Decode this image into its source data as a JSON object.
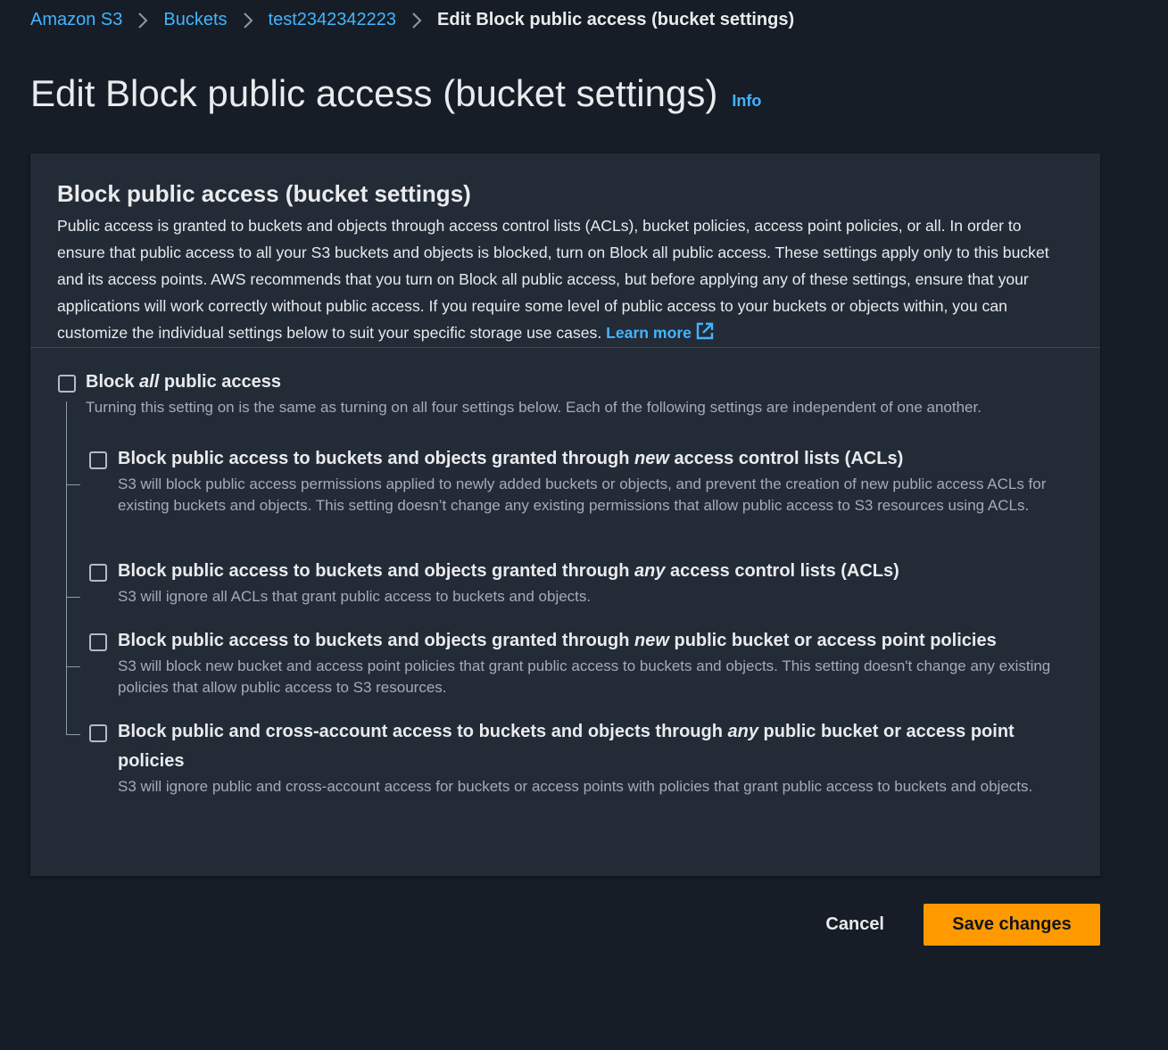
{
  "breadcrumb": {
    "items": [
      "Amazon S3",
      "Buckets",
      "test2342342223"
    ],
    "current": "Edit Block public access (bucket settings)"
  },
  "page": {
    "title": "Edit Block public access (bucket settings)",
    "info_label": "Info"
  },
  "panel": {
    "title": "Block public access (bucket settings)",
    "description": "Public access is granted to buckets and objects through access control lists (ACLs), bucket policies, access point policies, or all. In order to ensure that public access to all your S3 buckets and objects is blocked, turn on Block all public access. These settings apply only to this bucket and its access points. AWS recommends that you turn on Block all public access, but before applying any of these settings, ensure that your applications will work correctly without public access. If you require some level of public access to your buckets or objects within, you can customize the individual settings below to suit your specific storage use cases.",
    "learn_more": "Learn more"
  },
  "block_all": {
    "label_pre": "Block ",
    "label_em": "all",
    "label_post": " public access",
    "description": "Turning this setting on is the same as turning on all four settings below. Each of the following settings are independent of one another.",
    "checked": false
  },
  "options": [
    {
      "label_pre": "Block public access to buckets and objects granted through ",
      "label_em": "new",
      "label_post": " access control lists (ACLs)",
      "description": "S3 will block public access permissions applied to newly added buckets or objects, and prevent the creation of new public access ACLs for existing buckets and objects. This setting doesn’t change any existing permissions that allow public access to S3 resources using ACLs.",
      "checked": false
    },
    {
      "label_pre": "Block public access to buckets and objects granted through ",
      "label_em": "any",
      "label_post": " access control lists (ACLs)",
      "description": "S3 will ignore all ACLs that grant public access to buckets and objects.",
      "checked": false
    },
    {
      "label_pre": "Block public access to buckets and objects granted through ",
      "label_em": "new",
      "label_post": " public bucket or access point policies",
      "description": "S3 will block new bucket and access point policies that grant public access to buckets and objects. This setting doesn't change any existing policies that allow public access to S3 resources.",
      "checked": false
    },
    {
      "label_pre": "Block public and cross-account access to buckets and objects through ",
      "label_em": "any",
      "label_post": " public bucket or access point policies",
      "description": "S3 will ignore public and cross-account access for buckets or access points with policies that grant public access to buckets and objects.",
      "checked": false
    }
  ],
  "actions": {
    "cancel_label": "Cancel",
    "save_label": "Save changes"
  },
  "colors": {
    "background": "#161d26",
    "panel": "#232b37",
    "link": "#42b4ff",
    "primary_button": "#ff9900"
  }
}
